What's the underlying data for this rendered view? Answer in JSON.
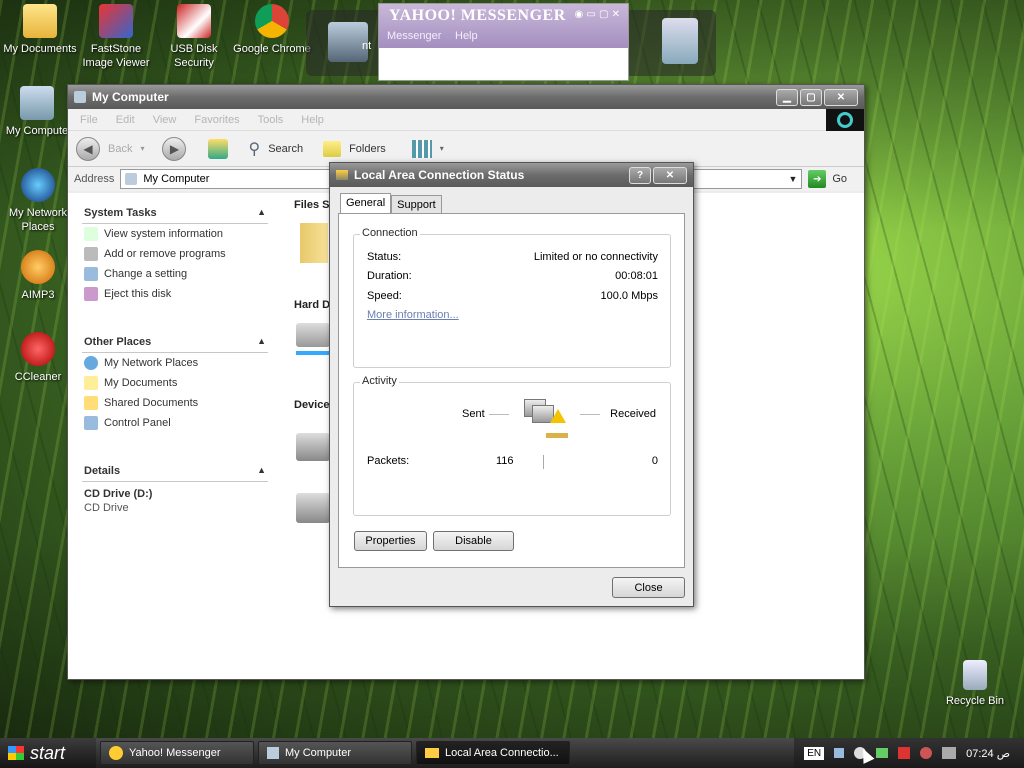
{
  "desktop": {
    "icons": [
      {
        "label": "My Documents"
      },
      {
        "label": "FastStone Image Viewer"
      },
      {
        "label": "USB Disk Security"
      },
      {
        "label": "Google Chrome"
      },
      {
        "label": "My Compute"
      },
      {
        "label": "My Network Places"
      },
      {
        "label": "AIMP3"
      },
      {
        "label": "CCleaner"
      },
      {
        "label": "Recycle Bin"
      }
    ],
    "dock_partial_label": "nt"
  },
  "yahoo": {
    "title": "YAHOO! MESSENGER",
    "menu_messenger": "Messenger",
    "menu_help": "Help"
  },
  "explorer": {
    "title": "My Computer",
    "menu": [
      "File",
      "Edit",
      "View",
      "Favorites",
      "Tools",
      "Help"
    ],
    "toolbar": {
      "back": "Back",
      "search": "Search",
      "folders": "Folders"
    },
    "address_label": "Address",
    "address_value": "My Computer",
    "go": "Go",
    "panels": {
      "system_tasks": {
        "title": "System Tasks",
        "items": [
          "View system information",
          "Add or remove programs",
          "Change a setting",
          "Eject this disk"
        ]
      },
      "other_places": {
        "title": "Other Places",
        "items": [
          "My Network Places",
          "My Documents",
          "Shared Documents",
          "Control Panel"
        ]
      },
      "details": {
        "title": "Details",
        "name": "CD Drive (D:)",
        "type": "CD Drive"
      }
    },
    "sections": {
      "files": "Files S",
      "hard": "Hard D",
      "devices": "Device"
    }
  },
  "dialog": {
    "title": "Local Area Connection Status",
    "tabs": [
      "General",
      "Support"
    ],
    "connection": {
      "legend": "Connection",
      "status_label": "Status:",
      "status_value": "Limited or no connectivity",
      "duration_label": "Duration:",
      "duration_value": "00:08:01",
      "speed_label": "Speed:",
      "speed_value": "100.0 Mbps",
      "more": "More information..."
    },
    "activity": {
      "legend": "Activity",
      "sent": "Sent",
      "received": "Received",
      "packets_label": "Packets:",
      "packets_sent": "116",
      "packets_received": "0"
    },
    "buttons": {
      "properties": "Properties",
      "disable": "Disable",
      "close": "Close"
    }
  },
  "taskbar": {
    "start": "start",
    "items": [
      "Yahoo! Messenger",
      "My Computer",
      "Local Area Connectio..."
    ],
    "lang": "EN",
    "clock": "07:24 ص"
  }
}
